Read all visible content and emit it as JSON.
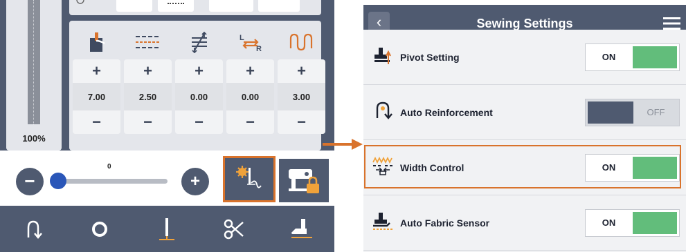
{
  "left_panel": {
    "gauge_label": "100%",
    "top_strip": [
      "",
      "",
      "",
      "",
      ""
    ],
    "params": [
      {
        "icon": "foot-pressure-icon",
        "plus": "+",
        "value": "7.00",
        "minus": "−"
      },
      {
        "icon": "stitch-length-icon",
        "plus": "+",
        "value": "2.50",
        "minus": "−"
      },
      {
        "icon": "feed-adjust-icon",
        "plus": "+",
        "value": "0.00",
        "minus": "−"
      },
      {
        "icon": "needle-position-icon",
        "plus": "+",
        "value": "0.00",
        "minus": "−"
      },
      {
        "icon": "stitch-width-icon",
        "plus": "+",
        "value": "3.00",
        "minus": "−"
      }
    ],
    "speed": {
      "value": "0",
      "minus": "−",
      "plus": "+"
    },
    "buttons": {
      "settings": "sewing-settings-icon",
      "lock": "machine-lock-icon"
    },
    "nav": [
      {
        "name": "reverse-icon"
      },
      {
        "name": "circle-icon"
      },
      {
        "name": "needle-icon"
      },
      {
        "name": "thread-cut-icon"
      },
      {
        "name": "presser-foot-icon"
      }
    ]
  },
  "settings_panel": {
    "title": "Sewing Settings",
    "back": "‹",
    "rows": [
      {
        "label": "Pivot Setting",
        "state": "ON",
        "icon": "pivot-icon"
      },
      {
        "label": "Auto Reinforcement",
        "state": "OFF",
        "icon": "auto-reinforcement-icon"
      },
      {
        "label": "Width Control",
        "state": "ON",
        "icon": "width-control-icon"
      },
      {
        "label": "Auto Fabric Sensor",
        "state": "ON",
        "icon": "fabric-sensor-icon"
      }
    ]
  },
  "colors": {
    "navy": "#4f5a70",
    "accent_orange": "#d9732c",
    "toggle_green": "#62bd7b",
    "slider_blue": "#2a56b8"
  }
}
